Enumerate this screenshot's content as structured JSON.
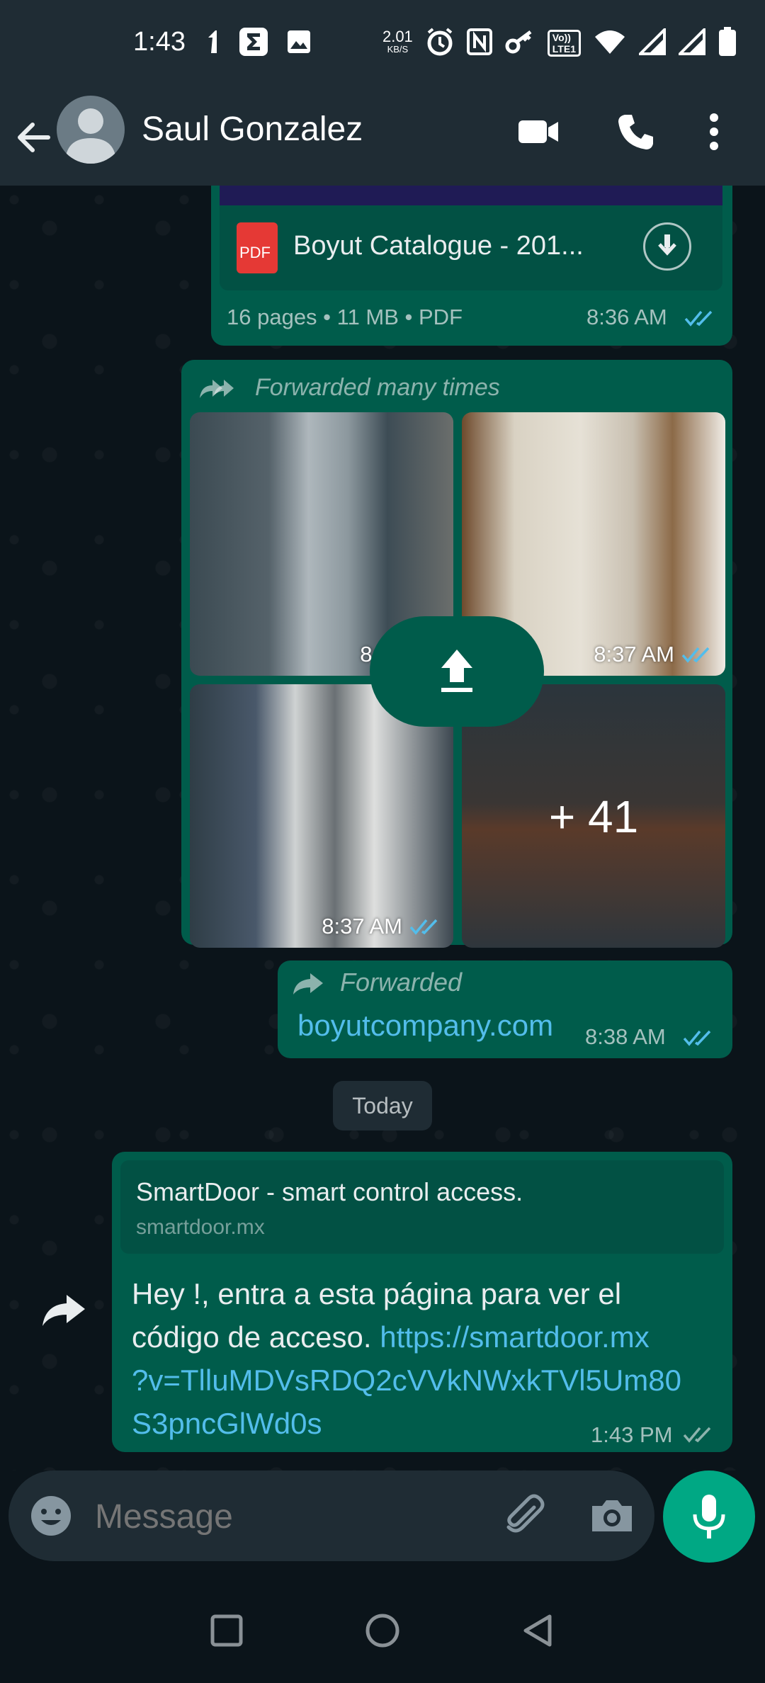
{
  "status_bar": {
    "time": "1:43",
    "net_speed_value": "2.01",
    "net_speed_unit": "KB/S",
    "volte_top": "Vo))",
    "volte_bottom": "LTE1"
  },
  "header": {
    "contact_name": "Saul Gonzalez"
  },
  "messages": {
    "pdf": {
      "file_name": "Boyut Catalogue - 201...",
      "file_badge": "PDF",
      "details": "16 pages • 11 MB • PDF",
      "time": "8:36 AM"
    },
    "album": {
      "forwarded_label": "Forwarded many times",
      "photo_times": [
        "8:37 AM",
        "8:37 AM",
        "8:37 AM"
      ],
      "more_count": "+ 41"
    },
    "link_message": {
      "forwarded_label": "Forwarded",
      "link_text": "boyutcompany.com",
      "time": "8:38 AM"
    },
    "date_divider": "Today",
    "smartdoor": {
      "preview_title": "SmartDoor - smart control access.",
      "preview_domain": "smartdoor.mx",
      "text_line1": "Hey !, entra a esta página para ver el",
      "text_line2_prefix": "código de acceso. ",
      "link_line1": "https://smartdoor.mx",
      "link_line2": "?v=TlluMDVsRDQ2cVVkNWxkTVl5Um80",
      "link_line3": "S3pncGlWd0s",
      "time": "1:43 PM"
    }
  },
  "composer": {
    "placeholder": "Message"
  },
  "colors": {
    "bubble_out": "#005c4b",
    "link": "#53bdeb",
    "accent": "#00a884",
    "read_ticks": "#53bdeb"
  }
}
